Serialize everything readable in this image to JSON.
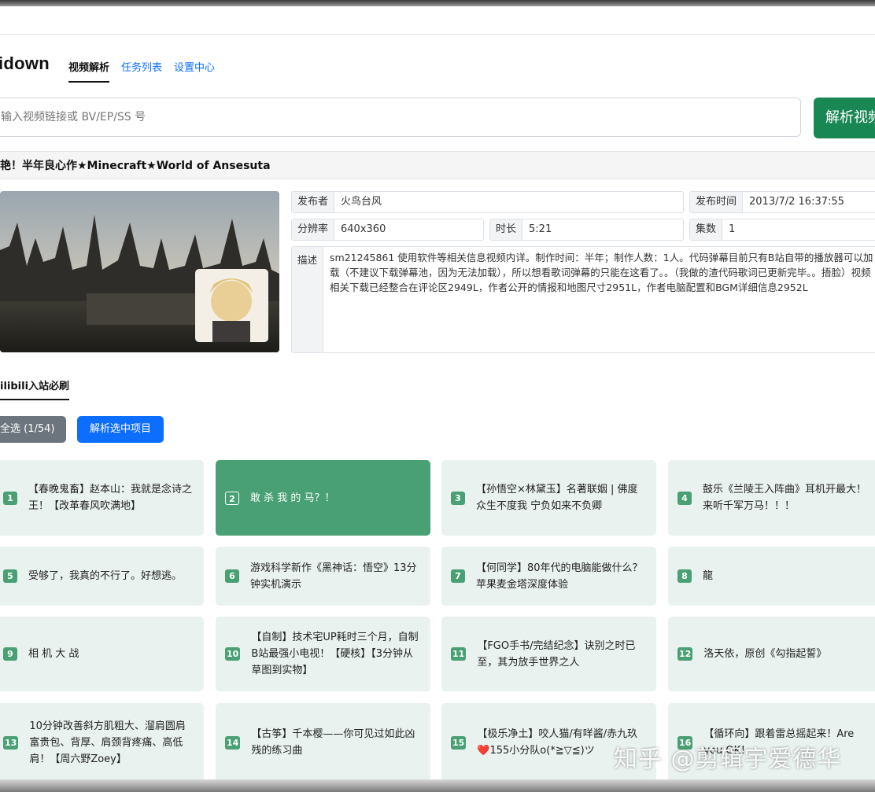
{
  "app": {
    "brand": "idown"
  },
  "tabs": [
    {
      "label": "视频解析",
      "active": true
    },
    {
      "label": "任务列表",
      "active": false
    },
    {
      "label": "设置中心",
      "active": false
    }
  ],
  "search": {
    "placeholder": "输入视频链接或 BV/EP/SS 号",
    "button_label": "解析视频"
  },
  "video": {
    "title": "艳！半年良心作★Minecraft★World of Ansesuta",
    "publisher_label": "发布者",
    "publisher": "火鸟台风",
    "publish_time_label": "发布时间",
    "publish_time": "2013/7/2 16:37:55",
    "resolution_label": "分辨率",
    "resolution": "640x360",
    "duration_label": "时长",
    "duration": "5:21",
    "episodes_label": "集数",
    "episodes": "1",
    "description_label": "描述",
    "description": "sm21245861 使用软件等相关信息视频内详。制作时间：半年；制作人数：1人。代码弹幕目前只有B站自带的播放器可以加载（不建议下载弹幕池，因为无法加载），所以想看歌词弹幕的只能在这看了。。（我做的渣代码歌词已更新完毕。。捂脸）视频相关下载已经整合在评论区2949L，作者公开的情报和地图尺寸2951L，作者电脑配置和BGM详细信息2952L"
  },
  "section": {
    "tab_label": "ilibili入站必刷"
  },
  "actions": {
    "select_all_label": "全选 (1/54)",
    "parse_selected_label": "解析选中项目"
  },
  "items": [
    {
      "num": "1",
      "title": "【春晚鬼畜】赵本山：我就是念诗之王！【改革春风吹满地】",
      "selected": false
    },
    {
      "num": "2",
      "title": "敢 杀 我 的 马？！",
      "selected": true
    },
    {
      "num": "3",
      "title": "【孙悟空×林黛玉】名著联姻 | 佛度众生不度我 宁负如来不负卿",
      "selected": false
    },
    {
      "num": "4",
      "title": "鼓乐《兰陵王入阵曲》耳机开最大！来听千军万马！！！",
      "selected": false
    },
    {
      "num": "5",
      "title": "受够了，我真的不行了。好想逃。",
      "selected": false
    },
    {
      "num": "6",
      "title": "游戏科学新作《黑神话：悟空》13分钟实机演示",
      "selected": false
    },
    {
      "num": "7",
      "title": "【何同学】80年代的电脑能做什么？苹果麦金塔深度体验",
      "selected": false
    },
    {
      "num": "8",
      "title": "龍",
      "selected": false
    },
    {
      "num": "9",
      "title": "相 机 大 战",
      "selected": false
    },
    {
      "num": "10",
      "title": "【自制】技术宅UP耗时三个月，自制B站最强小电视！【硬核】【3分钟从草图到实物】",
      "selected": false
    },
    {
      "num": "11",
      "title": "【FGO手书/完结纪念】诀别之时已至，其为放手世界之人",
      "selected": false
    },
    {
      "num": "12",
      "title": "洛天依，原创《勾指起誓》",
      "selected": false
    },
    {
      "num": "13",
      "title": "10分钟改善斜方肌粗大、溜肩圆肩富贵包、背厚、肩颈背疼痛、高低肩！【周六野Zoey】",
      "selected": false
    },
    {
      "num": "14",
      "title": "【古筝】千本樱——你可见过如此凶残的练习曲",
      "selected": false
    },
    {
      "num": "15",
      "title": "【极乐净土】咬人猫/有咩酱/赤九玖❤️155小分队o(*≧▽≦)ツ",
      "selected": false
    },
    {
      "num": "16",
      "title": "【循环向】跟着雷总摇起来！Are you OK！",
      "selected": false
    }
  ],
  "watermark": "知乎 @剪辑宇爱德华",
  "colors": {
    "accent_green": "#49a074",
    "card_bg": "#e9f2ee",
    "primary_blue": "#0d6efd",
    "success_green": "#198754",
    "gray": "#6c757d"
  }
}
